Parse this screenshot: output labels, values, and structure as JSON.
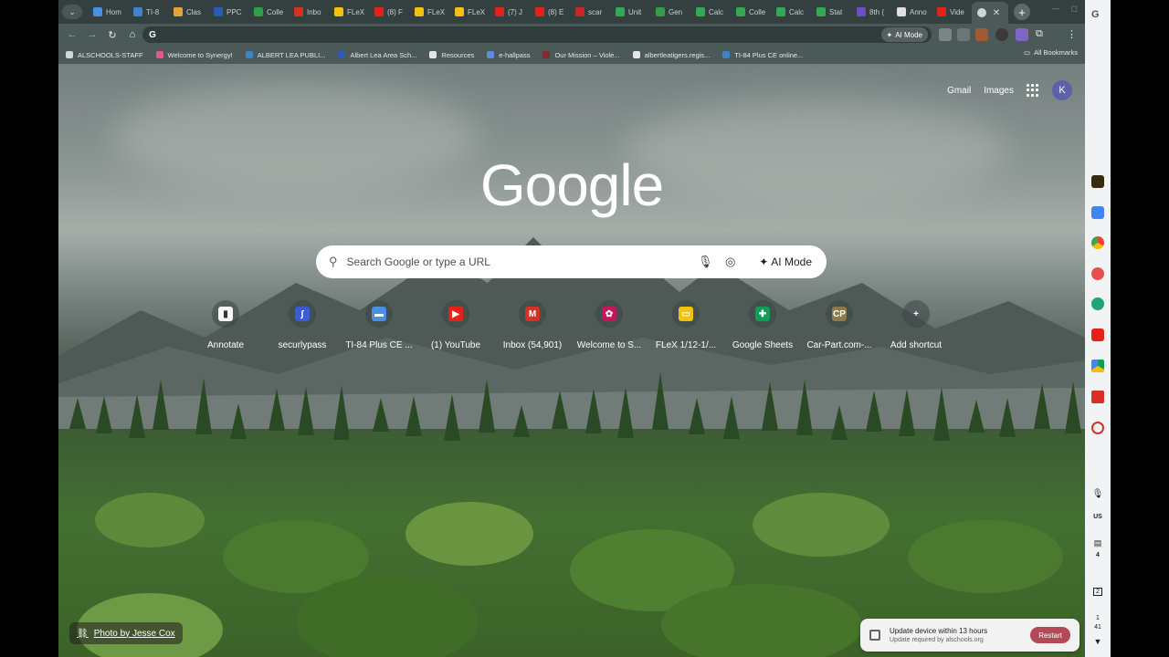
{
  "tabs": [
    {
      "label": "Hom",
      "color": "#4a90e2"
    },
    {
      "label": "TI-8",
      "color": "#3f83c9"
    },
    {
      "label": "Clas",
      "color": "#e8a23a"
    },
    {
      "label": "PPC",
      "color": "#2c5bb0"
    },
    {
      "label": "Colle",
      "color": "#2f9e44"
    },
    {
      "label": "Inbo",
      "color": "#d93025"
    },
    {
      "label": "FLeX",
      "color": "#f4c20d"
    },
    {
      "label": "(8) F",
      "color": "#e62117"
    },
    {
      "label": "FLeX",
      "color": "#f4c20d"
    },
    {
      "label": "FLeX",
      "color": "#f4c20d"
    },
    {
      "label": "(7) J",
      "color": "#e62117"
    },
    {
      "label": "(8) E",
      "color": "#e62117"
    },
    {
      "label": "scar",
      "color": "#c62828"
    },
    {
      "label": "Unit",
      "color": "#34a853"
    },
    {
      "label": "Gen",
      "color": "#2f9e44"
    },
    {
      "label": "Calc",
      "color": "#34a853"
    },
    {
      "label": "Colle",
      "color": "#34a853"
    },
    {
      "label": "Calc",
      "color": "#34a853"
    },
    {
      "label": "Stat",
      "color": "#34a853"
    },
    {
      "label": "8th (",
      "color": "#6a4fc9"
    },
    {
      "label": "Anno",
      "color": "#e0e0e0"
    },
    {
      "label": "Vide",
      "color": "#e62117"
    }
  ],
  "omnibox": {
    "value": "",
    "ai_mode": "AI Mode"
  },
  "bookmarks": [
    {
      "label": "ALSCHOOLS-STAFF",
      "color": "#cfd6d5"
    },
    {
      "label": "Welcome to Synergy!",
      "color": "#e05a8a"
    },
    {
      "label": "ALBERT LEA PUBLI...",
      "color": "#3f83c9"
    },
    {
      "label": "Albert Lea Area Sch...",
      "color": "#2c5bb0"
    },
    {
      "label": "Resources",
      "color": "#e3e8e7"
    },
    {
      "label": "e-hallpass",
      "color": "#5b8dd9"
    },
    {
      "label": "Our Mission – Viole...",
      "color": "#7a2e2e"
    },
    {
      "label": "albertleatigers.regis...",
      "color": "#e3e8e7"
    },
    {
      "label": "TI-84 Plus CE online...",
      "color": "#3f83c9"
    }
  ],
  "all_bookmarks": "All Bookmarks",
  "top_links": {
    "gmail": "Gmail",
    "images": "Images",
    "avatar": "K"
  },
  "logo": "Google",
  "search": {
    "placeholder": "Search Google or type a URL",
    "ai_mode": "AI Mode"
  },
  "shortcuts": [
    {
      "label": "Annotate",
      "icon": "document-icon",
      "color": "#f5f5f5",
      "glyph": "▮"
    },
    {
      "label": "securlypass",
      "icon": "securly-icon",
      "color": "#3b5bdb",
      "glyph": "∫"
    },
    {
      "label": "TI-84 Plus CE ...",
      "icon": "ti84-icon",
      "color": "#4a90e2",
      "glyph": "▬"
    },
    {
      "label": "(1) YouTube",
      "icon": "youtube-icon",
      "color": "#e62117",
      "glyph": "▶"
    },
    {
      "label": "Inbox (54,901)",
      "icon": "gmail-icon",
      "color": "#d93025",
      "glyph": "M"
    },
    {
      "label": "Welcome to S...",
      "icon": "synergy-icon",
      "color": "#c2185b",
      "glyph": "✿"
    },
    {
      "label": "FLeX 1/12-1/...",
      "icon": "slides-icon",
      "color": "#f4c20d",
      "glyph": "▭"
    },
    {
      "label": "Google Sheets",
      "icon": "sheets-icon",
      "color": "#0f9d58",
      "glyph": "✚"
    },
    {
      "label": "Car-Part.com-...",
      "icon": "carpart-icon",
      "color": "#8d7b4a",
      "glyph": "CP"
    },
    {
      "label": "Add shortcut",
      "icon": "plus-icon",
      "color": "transparent",
      "glyph": "+"
    }
  ],
  "photo_credit": "Photo by Jesse Cox",
  "toast": {
    "title": "Update device within 13 hours",
    "subtitle": "Update required by alschools.org",
    "button": "Restart"
  },
  "shelf": {
    "lang": "US",
    "badge1": "4",
    "badge2": "2",
    "time_h": "1",
    "time_m": "41"
  }
}
